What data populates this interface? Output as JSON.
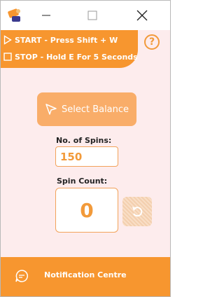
{
  "window": {
    "minimize_glyph": "—",
    "maximize_glyph": "☐",
    "close_glyph": "✕"
  },
  "hotkeys": {
    "start": "START - Press Shift + W",
    "stop": "STOP - Hold E For 5 Seconds"
  },
  "help": {
    "glyph": "?"
  },
  "select_balance": {
    "label": "Select Balance"
  },
  "spins": {
    "label": "No. of Spins:",
    "value": "150"
  },
  "spin_count": {
    "label": "Spin Count:",
    "value": "0"
  },
  "footer": {
    "label": "Notification Centre"
  },
  "colors": {
    "accent": "#f7962f",
    "button_light": "#f9ad69",
    "background": "#fdeced",
    "text_orange": "#f29a3a"
  },
  "icons": [
    "app-icon",
    "minimize-icon",
    "maximize-icon",
    "close-icon",
    "play-icon",
    "stop-icon",
    "help-icon",
    "cursor-icon",
    "reset-icon",
    "chat-icon"
  ]
}
